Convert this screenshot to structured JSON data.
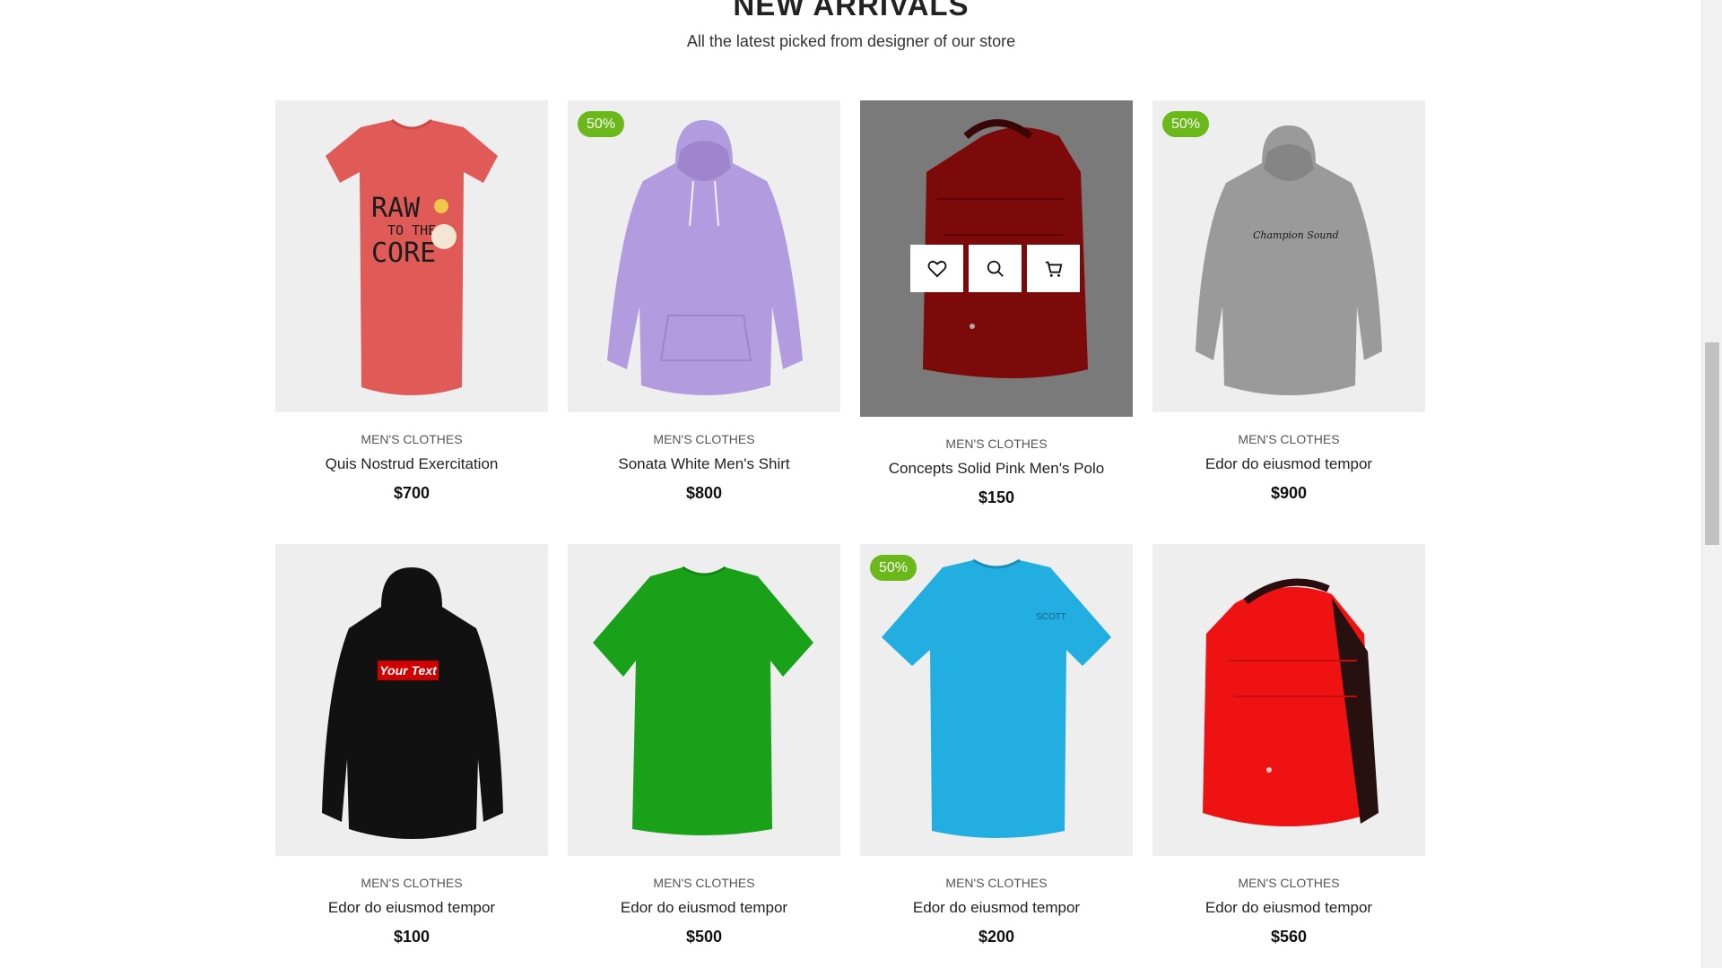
{
  "section": {
    "title": "NEW ARRIVALS",
    "subtitle": "All the latest picked from designer of our store"
  },
  "colors": {
    "badge": "#6ab81a",
    "card_bg": "#eeeeee",
    "hover_overlay": "#7a7a7a"
  },
  "overlay_actions": [
    {
      "icon": "heart-icon"
    },
    {
      "icon": "search-icon"
    },
    {
      "icon": "cart-icon"
    }
  ],
  "products": [
    {
      "category": "MEN'S CLOTHES",
      "name": "Quis Nostrud Exercitation",
      "price": "$700",
      "badge": "",
      "image": "red-tshirt",
      "print": "RAW TO THE CORE"
    },
    {
      "category": "MEN'S CLOTHES",
      "name": "Sonata White Men's Shirt",
      "price": "$800",
      "badge": "50%",
      "image": "purple-hoodie"
    },
    {
      "category": "MEN'S CLOTHES",
      "name": "Concepts Solid Pink Men's Polo",
      "price": "$150",
      "badge": "",
      "image": "red-backpack-hover"
    },
    {
      "category": "MEN'S CLOTHES",
      "name": "Edor do eiusmod tempor",
      "price": "$900",
      "badge": "50%",
      "image": "grey-hoodie",
      "print": "Champion Sound"
    },
    {
      "category": "MEN'S CLOTHES",
      "name": "Edor do eiusmod tempor",
      "price": "$100",
      "badge": "",
      "image": "black-hoodie",
      "print": "Your Text"
    },
    {
      "category": "MEN'S CLOTHES",
      "name": "Edor do eiusmod tempor",
      "price": "$500",
      "badge": "",
      "image": "green-tshirt"
    },
    {
      "category": "MEN'S CLOTHES",
      "name": "Edor do eiusmod tempor",
      "price": "$200",
      "badge": "50%",
      "image": "blue-tshirt",
      "print": "SCOTT"
    },
    {
      "category": "MEN'S CLOTHES",
      "name": "Edor do eiusmod tempor",
      "price": "$560",
      "badge": "",
      "image": "red-backpack"
    }
  ]
}
